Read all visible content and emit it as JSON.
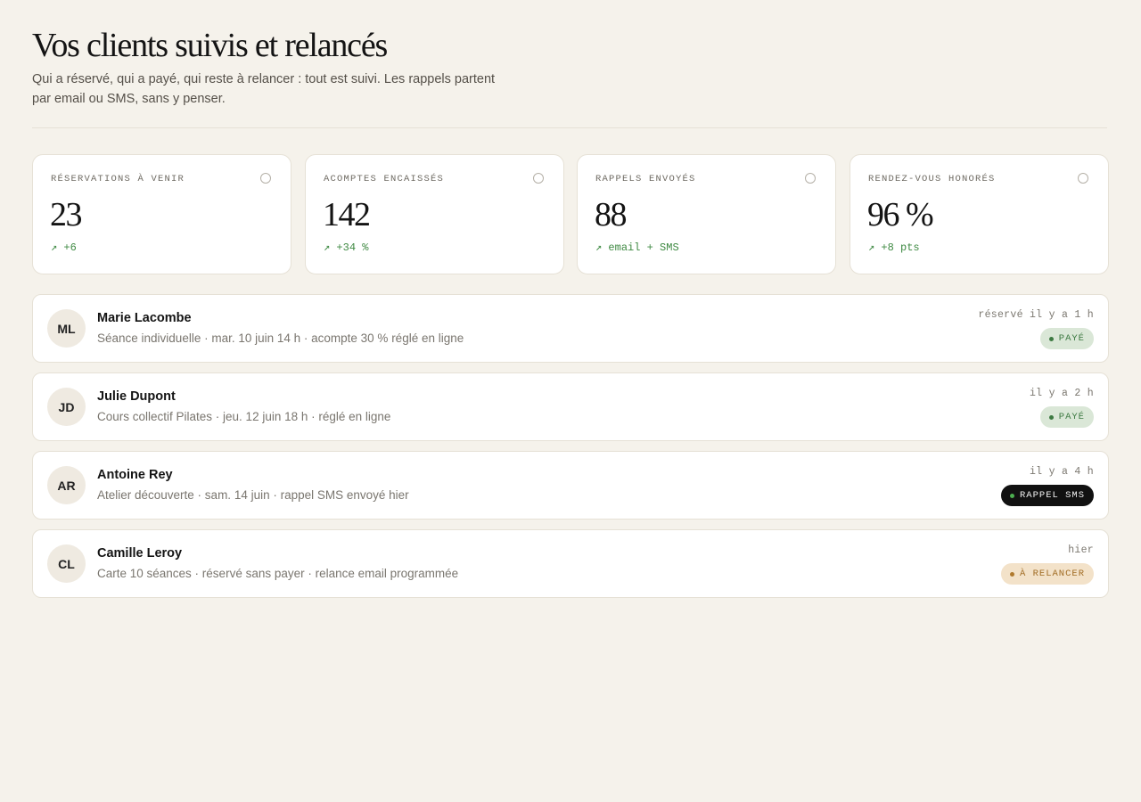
{
  "header": {
    "title": "Vos clients suivis et relancés",
    "subtitle": "Qui a réservé, qui a payé, qui reste à relancer : tout est suivi. Les rappels partent par email ou SMS, sans y penser."
  },
  "stats": [
    {
      "label": "RÉSERVATIONS À VENIR",
      "value": "23",
      "trend": "↗ +6",
      "icon": "circle-icon"
    },
    {
      "label": "ACOMPTES ENCAISSÉS",
      "value": "142",
      "trend": "↗ +34 %",
      "icon": "circle-icon"
    },
    {
      "label": "RAPPELS ENVOYÉS",
      "value": "88",
      "trend": "↗ email + SMS",
      "icon": "circle-icon"
    },
    {
      "label": "RENDEZ-VOUS HONORÉS",
      "value": "96 %",
      "trend": "↗ +8 pts",
      "icon": "circle-icon"
    }
  ],
  "clients": [
    {
      "initials": "ML",
      "name": "Marie Lacombe",
      "detail": "Séance individuelle · mar. 10 juin 14 h · acompte 30 % réglé en ligne",
      "time": "réservé il y a 1 h",
      "status": "PAYÉ",
      "status_kind": "paid"
    },
    {
      "initials": "JD",
      "name": "Julie Dupont",
      "detail": "Cours collectif Pilates · jeu. 12 juin 18 h · réglé en ligne",
      "time": "il y a 2 h",
      "status": "PAYÉ",
      "status_kind": "paid"
    },
    {
      "initials": "AR",
      "name": "Antoine Rey",
      "detail": "Atelier découverte · sam. 14 juin · rappel SMS envoyé hier",
      "time": "il y a 4 h",
      "status": "RAPPEL SMS",
      "status_kind": "sms"
    },
    {
      "initials": "CL",
      "name": "Camille Leroy",
      "detail": "Carte 10 séances · réservé sans payer · relance email programmée",
      "time": "hier",
      "status": "À RELANCER",
      "status_kind": "relance"
    }
  ],
  "colors": {
    "background": "#f5f2eb",
    "card": "#ffffff",
    "positive": "#3f8a43",
    "paid_bg": "#dae7d7",
    "sms_bg": "#111111",
    "relance_bg": "#f3e2c9"
  }
}
